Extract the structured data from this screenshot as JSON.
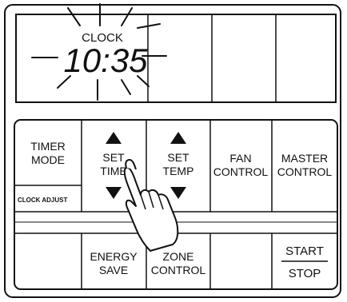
{
  "display": {
    "clock_label": "CLOCK",
    "clock_time": "10:35"
  },
  "buttons": {
    "timer_mode": [
      "TIMER",
      "MODE"
    ],
    "clock_adjust": "CLOCK ADJUST",
    "set_time": [
      "SET",
      "TIME"
    ],
    "set_temp": [
      "SET",
      "TEMP"
    ],
    "fan_control": [
      "FAN",
      "CONTROL"
    ],
    "master_control": [
      "MASTER",
      "CONTROL"
    ],
    "energy_save": [
      "ENERGY",
      "SAVE"
    ],
    "zone_control": [
      "ZONE",
      "CONTROL"
    ],
    "start": "START",
    "stop": "STOP"
  },
  "icons": {
    "up": "triangle-up",
    "down": "triangle-down",
    "flash": "blink-rays",
    "pointer": "hand-pressing"
  }
}
